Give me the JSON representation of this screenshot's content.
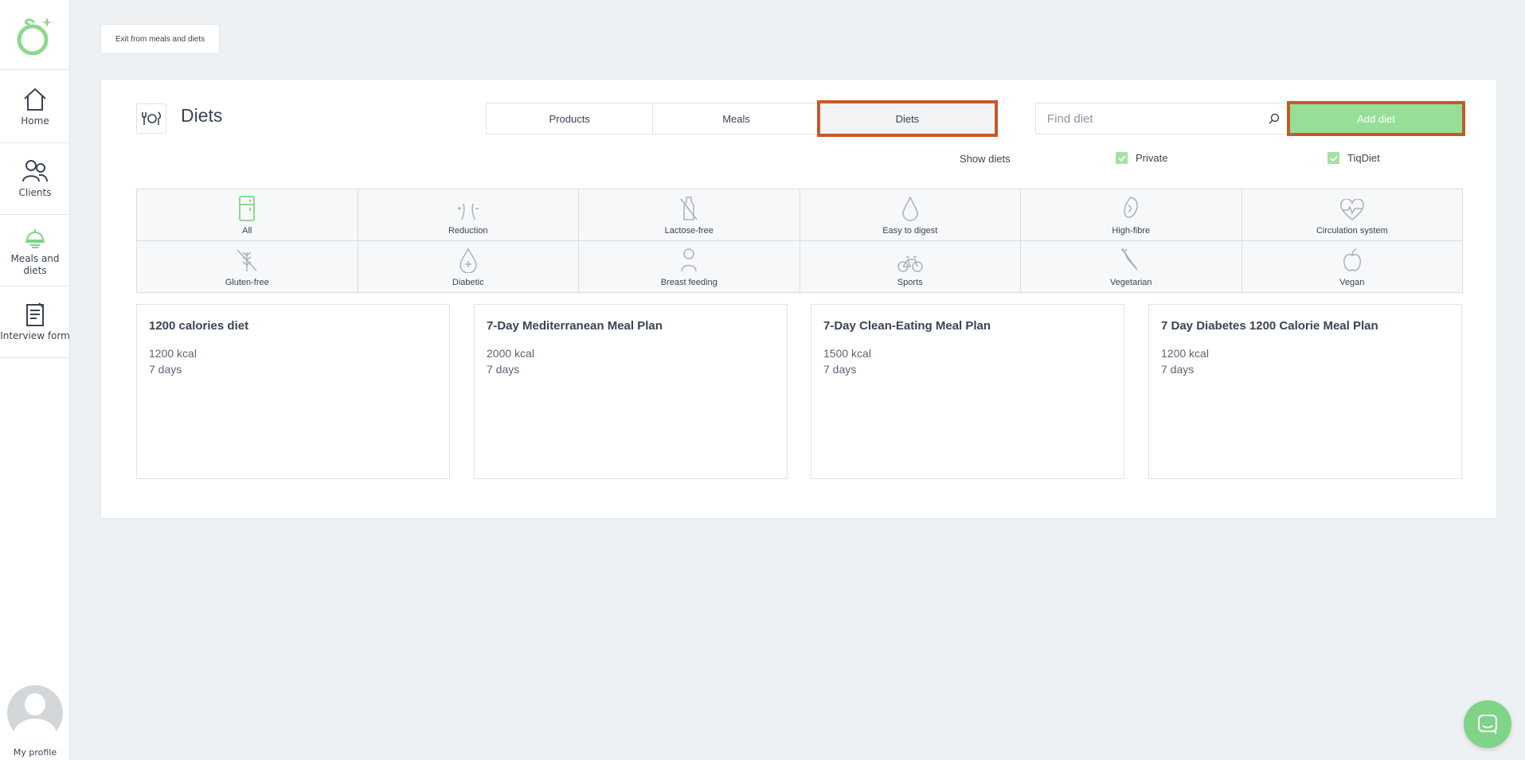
{
  "sidebar": {
    "items": [
      {
        "label": "Home",
        "icon": "home-icon"
      },
      {
        "label": "Clients",
        "icon": "clients-icon"
      },
      {
        "label": "Meals and diets",
        "icon": "meals-icon"
      },
      {
        "label": "Interview form",
        "icon": "interview-form-icon"
      }
    ],
    "profile_label": "My profile"
  },
  "exit_button": "Exit from meals and diets",
  "header": {
    "title": "Diets",
    "tabs": [
      "Products",
      "Meals",
      "Diets"
    ],
    "active_tab": "Diets",
    "search_placeholder": "Find diet",
    "add_button": "Add diet"
  },
  "filters": {
    "show_label": "Show diets",
    "private": "Private",
    "tiqdiet": "TiqDiet"
  },
  "categories": [
    {
      "label": "All",
      "icon": "fridge-icon"
    },
    {
      "label": "Reduction",
      "icon": "waist-icon"
    },
    {
      "label": "Lactose-free",
      "icon": "milk-bottle-icon"
    },
    {
      "label": "Easy to digest",
      "icon": "drop-icon"
    },
    {
      "label": "High-fibre",
      "icon": "fibre-icon"
    },
    {
      "label": "Circulation system",
      "icon": "heart-pulse-icon"
    },
    {
      "label": "Gluten-free",
      "icon": "wheat-crossed-icon"
    },
    {
      "label": "Diabetic",
      "icon": "blood-drop-plus-icon"
    },
    {
      "label": "Breast feeding",
      "icon": "mother-icon"
    },
    {
      "label": "Sports",
      "icon": "bicycle-icon"
    },
    {
      "label": "Vegetarian",
      "icon": "carrot-icon"
    },
    {
      "label": "Vegan",
      "icon": "apple-icon"
    }
  ],
  "diets": [
    {
      "title": "1200 calories diet",
      "kcal": "1200 kcal",
      "days": "7 days"
    },
    {
      "title": "7-Day Mediterranean Meal Plan",
      "kcal": "2000 kcal",
      "days": "7 days"
    },
    {
      "title": "7-Day Clean-Eating Meal Plan",
      "kcal": "1500 kcal",
      "days": "7 days"
    },
    {
      "title": "7 Day Diabetes 1200 Calorie Meal Plan",
      "kcal": "1200 kcal",
      "days": "7 days"
    }
  ],
  "colors": {
    "accent_green": "#97df96",
    "highlight_orange": "#c8582a",
    "text": "#3b4453"
  }
}
